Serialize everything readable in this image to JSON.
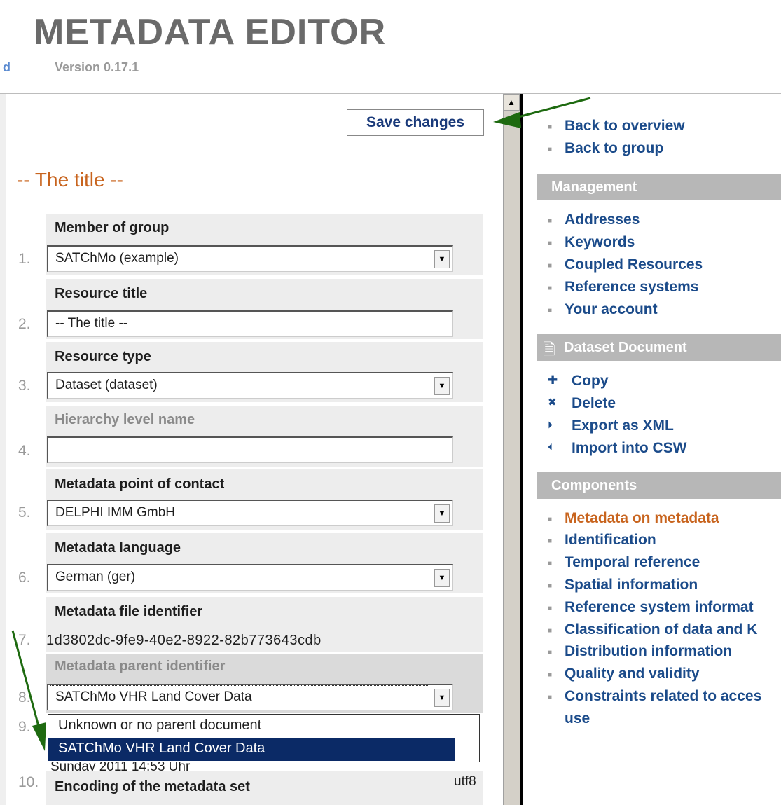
{
  "header": {
    "title": "METADATA  EDITOR",
    "version": "Version 0.17.1",
    "left_fragment": "d"
  },
  "toolbar": {
    "save_label": "Save changes"
  },
  "form": {
    "title": "-- The title --",
    "fields": [
      {
        "num": "1.",
        "label": "Member of group",
        "value": "SATChMo (example)"
      },
      {
        "num": "2.",
        "label": "Resource title",
        "value": "-- The title --"
      },
      {
        "num": "3.",
        "label": "Resource type",
        "value": "Dataset (dataset)"
      },
      {
        "num": "4.",
        "label": "Hierarchy level name",
        "value": ""
      },
      {
        "num": "5.",
        "label": "Metadata point of contact",
        "value": "DELPHI IMM GmbH"
      },
      {
        "num": "6.",
        "label": "Metadata language",
        "value": "German (ger)"
      },
      {
        "num": "7.",
        "label": "Metadata file identifier",
        "value": "1d3802dc-9fe9-40e2-8922-82b773643cdb"
      },
      {
        "num": "8.",
        "label": "Metadata parent identifier",
        "value": "SATChMo VHR Land Cover Data"
      },
      {
        "num": "9.",
        "label": "",
        "value": "Sunday 2011 14:53 Uhr"
      },
      {
        "num": "10.",
        "label": "Encoding of the metadata set",
        "value": "utf8"
      }
    ],
    "parent_dropdown": {
      "options": [
        "Unknown or no parent document",
        "SATChMo VHR Land Cover Data"
      ],
      "selected_index": 1
    }
  },
  "nav": {
    "top_links": [
      "Back to overview",
      "Back to group"
    ],
    "management": {
      "title": "Management",
      "links": [
        "Addresses",
        "Keywords",
        "Coupled Resources",
        "Reference systems",
        "Your account"
      ]
    },
    "document": {
      "title": "Dataset Document",
      "actions": [
        "Copy",
        "Delete",
        "Export as XML",
        "Import into CSW"
      ]
    },
    "components": {
      "title": "Components",
      "links": [
        "Metadata on metadata",
        "Identification",
        "Temporal reference",
        "Spatial information",
        "Reference system informat",
        "Classification of data and K",
        "Distribution information",
        "Quality and validity",
        "Constraints related to acces",
        "use"
      ],
      "active_color": "#c8641e"
    }
  },
  "colors": {
    "link": "#1b4b8a",
    "accent": "#c8641e",
    "selection": "#0b2a66",
    "section_header": "#b7b7b7"
  }
}
